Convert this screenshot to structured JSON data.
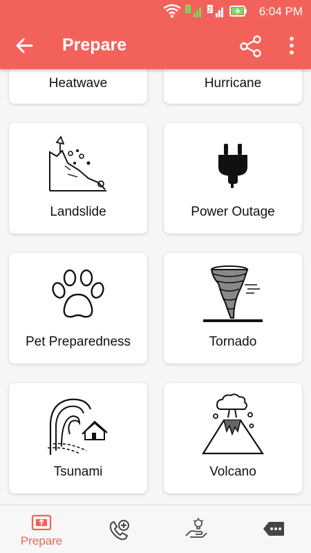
{
  "status": {
    "time": "6:04 PM",
    "sim1_label": "1",
    "sim2_label": "2",
    "icons": [
      "wifi-icon",
      "signal-sim1-icon",
      "signal-sim2-icon",
      "battery-charging-icon"
    ]
  },
  "appbar": {
    "title": "Prepare",
    "icons": [
      "back-arrow-icon",
      "share-icon",
      "more-vert-icon"
    ]
  },
  "cards": [
    {
      "label": "Heatwave"
    },
    {
      "label": "Hurricane"
    },
    {
      "label": "Landslide",
      "icon": "landslide-icon"
    },
    {
      "label": "Power Outage",
      "icon": "power-plug-icon"
    },
    {
      "label": "Pet Preparedness",
      "icon": "paw-icon"
    },
    {
      "label": "Tornado",
      "icon": "tornado-icon"
    },
    {
      "label": "Tsunami",
      "icon": "tsunami-icon"
    },
    {
      "label": "Volcano",
      "icon": "volcano-icon"
    }
  ],
  "bottom_nav": {
    "items": [
      {
        "label": "Prepare",
        "icon": "prepare-icon",
        "active": true
      },
      {
        "label": "",
        "icon": "phone-add-icon"
      },
      {
        "label": "",
        "icon": "hand-lightbulb-icon"
      },
      {
        "label": "",
        "icon": "more-tag-icon"
      }
    ]
  },
  "colors": {
    "primary": "#f3625a",
    "card_bg": "#ffffff",
    "page_bg": "#f6f6f6"
  }
}
